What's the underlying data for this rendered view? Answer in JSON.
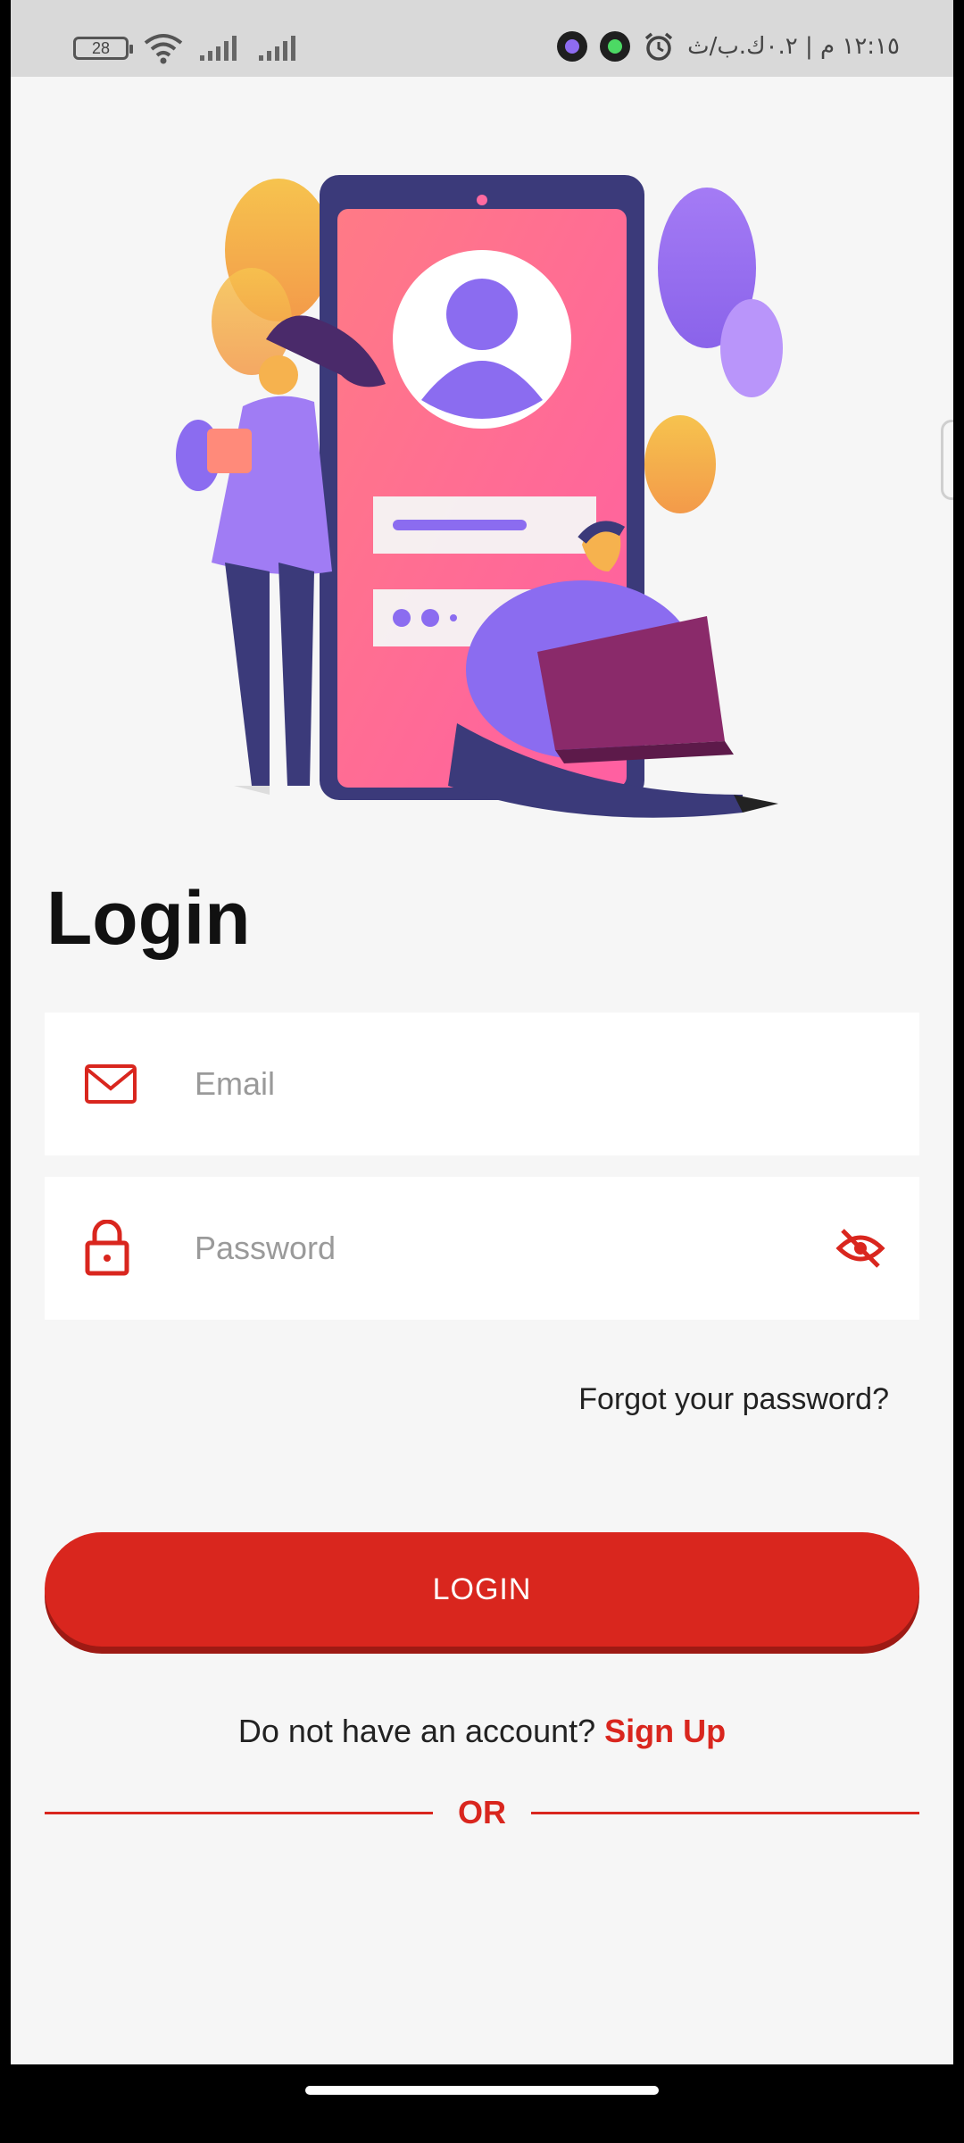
{
  "status_bar": {
    "battery_level": "28",
    "time_text": "١٢:١٥ م | ٠.٢ك.ب/ث",
    "icons": [
      "battery-icon",
      "wifi-icon",
      "signal-icon",
      "signal-icon",
      "app-icon",
      "app-icon",
      "alarm-icon"
    ]
  },
  "illustration": {
    "name": "login-illustration",
    "colors": {
      "phone_frame": "#3b3a7a",
      "screen_gradient_start": "#ff7a86",
      "screen_gradient_end": "#ff6aa0",
      "purple": "#8b6cf0",
      "yellow": "#f6b73c"
    }
  },
  "login": {
    "title": "Login",
    "email": {
      "placeholder": "Email",
      "icon": "mail-icon"
    },
    "password": {
      "placeholder": "Password",
      "icon": "lock-icon",
      "toggle_icon": "eye-off-icon"
    },
    "forgot_label": "Forgot your password?",
    "button_label": "LOGIN",
    "signup_prompt": "Do not have an account?",
    "signup_link": "Sign Up",
    "or_label": "OR"
  },
  "colors": {
    "accent": "#d9261e",
    "background": "#f6f6f6",
    "field_background": "#ffffff"
  }
}
